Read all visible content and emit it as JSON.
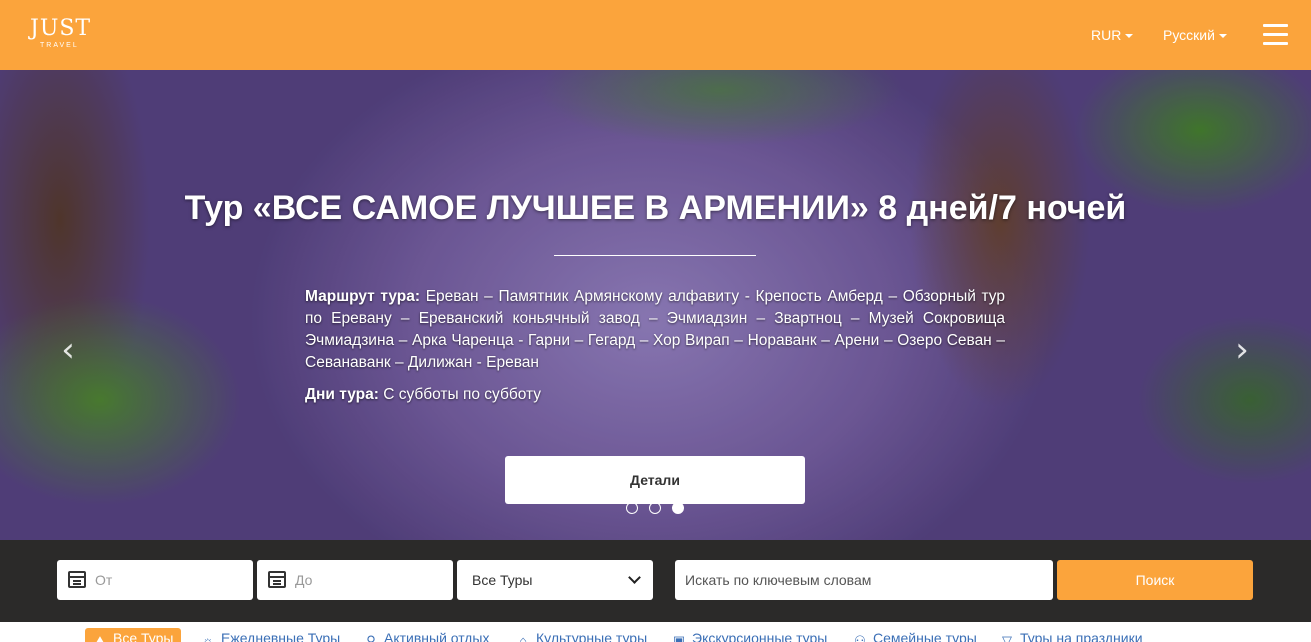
{
  "header": {
    "logo_main": "JUST",
    "logo_sub": "TRAVEL",
    "currency": "RUR",
    "language": "Русский"
  },
  "hero": {
    "title": "Тур «ВСЕ САМОЕ ЛУЧШЕЕ В АРМЕНИИ» 8 дней/7 ночей",
    "route_label": "Маршрут тура:",
    "route_text": "Ереван – Памятник Армянскому алфавиту - Крепость Амберд – Обзорный тур по Еревану – Ереванский коньячный завод – Эчмиадзин – Звартноц – Музей Сокровища Эчмиадзина – Арка Чаренца - Гарни – Гегард – Хор Вирап – Нораванк – Арени – Озеро Севан – Севанаванк – Дилижан - Ереван",
    "days_label": "Дни тура:",
    "days_text": "С субботы по субботу",
    "details_button": "Детали",
    "slides": {
      "count": 3,
      "active_index": 2
    }
  },
  "search": {
    "from_placeholder": "От",
    "to_placeholder": "До",
    "tour_select": "Все Туры",
    "keyword_placeholder": "Искать по ключевым словам",
    "search_button": "Поиск"
  },
  "categories": [
    {
      "label": "Все Туры",
      "icon": "map-icon",
      "active": true
    },
    {
      "label": "Ежедневные Туры",
      "icon": "sun-icon",
      "active": false
    },
    {
      "label": "Активный отдых",
      "icon": "bicycle-icon",
      "active": false
    },
    {
      "label": "Культурные туры",
      "icon": "monument-icon",
      "active": false
    },
    {
      "label": "Экскурсионные туры",
      "icon": "bus-icon",
      "active": false
    },
    {
      "label": "Семейные туры",
      "icon": "family-icon",
      "active": false
    },
    {
      "label": "Туры на праздники",
      "icon": "cocktail-icon",
      "active": false
    }
  ],
  "colors": {
    "brand_orange": "#fba43c",
    "search_bar_bg": "#2b2a29",
    "link_blue": "#3b6fb6"
  }
}
